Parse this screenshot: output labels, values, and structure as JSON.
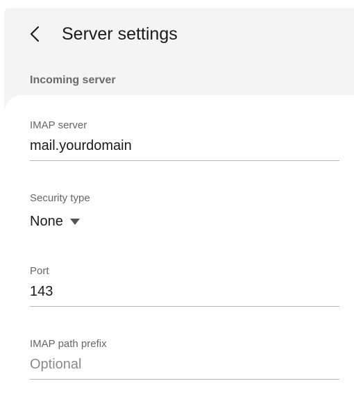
{
  "header": {
    "title": "Server settings",
    "back_icon": "chevron-left-icon"
  },
  "section": {
    "title": "Incoming server"
  },
  "fields": {
    "imap_server": {
      "label": "IMAP server",
      "value": "mail.yourdomain"
    },
    "security_type": {
      "label": "Security type",
      "value": "None",
      "icon": "caret-down-icon"
    },
    "port": {
      "label": "Port",
      "value": "143"
    },
    "imap_path_prefix": {
      "label": "IMAP path prefix",
      "value": "",
      "placeholder": "Optional"
    }
  },
  "colors": {
    "background": "#f4f4f4",
    "card": "#ffffff",
    "text_primary": "#1a1a1a",
    "text_secondary": "#666666",
    "divider": "#b5b5b5"
  }
}
